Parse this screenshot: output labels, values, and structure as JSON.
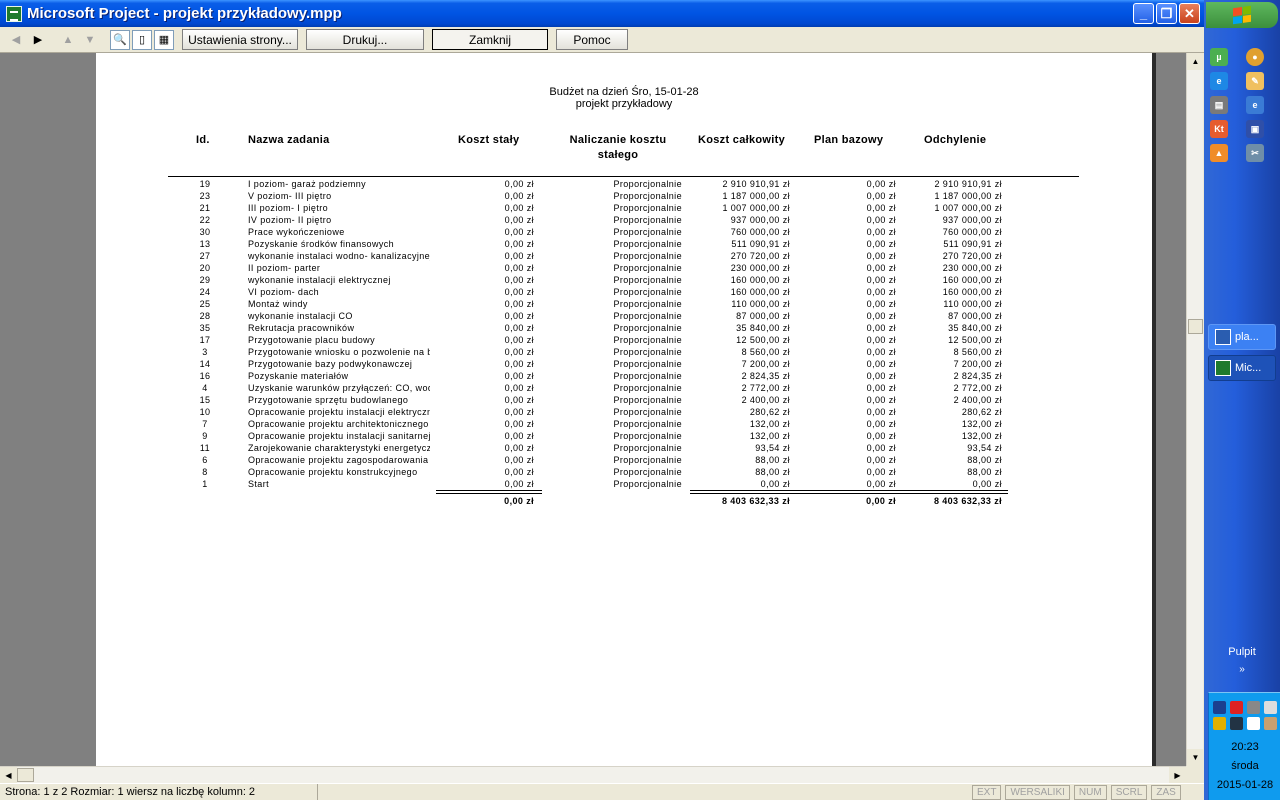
{
  "window": {
    "title": "Microsoft Project - projekt przykładowy.mpp"
  },
  "toolbar": {
    "page_setup": "Ustawienia strony...",
    "print": "Drukuj...",
    "close": "Zamknij",
    "help": "Pomoc"
  },
  "report": {
    "title": "Budżet na dzień Śro, 15-01-28",
    "project": "projekt przykładowy",
    "columns": {
      "id": "Id.",
      "name": "Nazwa zadania",
      "fixed_cost": "Koszt stały",
      "accrual_l1": "Naliczanie kosztu",
      "accrual_l2": "stałego",
      "total_cost": "Koszt całkowity",
      "baseline": "Plan bazowy",
      "variance": "Odchylenie"
    },
    "rows": [
      {
        "id": "19",
        "name": "I poziom- garaż podziemny",
        "fixed": "0,00 zł",
        "accrual": "Proporcjonalnie",
        "total": "2 910 910,91 zł",
        "baseline": "0,00 zł",
        "variance": "2 910 910,91 zł"
      },
      {
        "id": "23",
        "name": "V poziom- III piętro",
        "fixed": "0,00 zł",
        "accrual": "Proporcjonalnie",
        "total": "1 187 000,00 zł",
        "baseline": "0,00 zł",
        "variance": "1 187 000,00 zł"
      },
      {
        "id": "21",
        "name": "III poziom- I piętro",
        "fixed": "0,00 zł",
        "accrual": "Proporcjonalnie",
        "total": "1 007 000,00 zł",
        "baseline": "0,00 zł",
        "variance": "1 007 000,00 zł"
      },
      {
        "id": "22",
        "name": "IV poziom- II piętro",
        "fixed": "0,00 zł",
        "accrual": "Proporcjonalnie",
        "total": "937 000,00 zł",
        "baseline": "0,00 zł",
        "variance": "937 000,00 zł"
      },
      {
        "id": "30",
        "name": "Prace wykończeniowe",
        "fixed": "0,00 zł",
        "accrual": "Proporcjonalnie",
        "total": "760 000,00 zł",
        "baseline": "0,00 zł",
        "variance": "760 000,00 zł"
      },
      {
        "id": "13",
        "name": "Pozyskanie środków finansowych",
        "fixed": "0,00 zł",
        "accrual": "Proporcjonalnie",
        "total": "511 090,91 zł",
        "baseline": "0,00 zł",
        "variance": "511 090,91 zł"
      },
      {
        "id": "27",
        "name": "wykonanie instalaci wodno- kanalizacyjnej",
        "fixed": "0,00 zł",
        "accrual": "Proporcjonalnie",
        "total": "270 720,00 zł",
        "baseline": "0,00 zł",
        "variance": "270 720,00 zł"
      },
      {
        "id": "20",
        "name": "II poziom- parter",
        "fixed": "0,00 zł",
        "accrual": "Proporcjonalnie",
        "total": "230 000,00 zł",
        "baseline": "0,00 zł",
        "variance": "230 000,00 zł"
      },
      {
        "id": "29",
        "name": "wykonanie instalacji elektrycznej",
        "fixed": "0,00 zł",
        "accrual": "Proporcjonalnie",
        "total": "160 000,00 zł",
        "baseline": "0,00 zł",
        "variance": "160 000,00 zł"
      },
      {
        "id": "24",
        "name": "VI poziom- dach",
        "fixed": "0,00 zł",
        "accrual": "Proporcjonalnie",
        "total": "160 000,00 zł",
        "baseline": "0,00 zł",
        "variance": "160 000,00 zł"
      },
      {
        "id": "25",
        "name": "Montaż windy",
        "fixed": "0,00 zł",
        "accrual": "Proporcjonalnie",
        "total": "110 000,00 zł",
        "baseline": "0,00 zł",
        "variance": "110 000,00 zł"
      },
      {
        "id": "28",
        "name": "wykonanie instalacji CO",
        "fixed": "0,00 zł",
        "accrual": "Proporcjonalnie",
        "total": "87 000,00 zł",
        "baseline": "0,00 zł",
        "variance": "87 000,00 zł"
      },
      {
        "id": "35",
        "name": "Rekrutacja pracowników",
        "fixed": "0,00 zł",
        "accrual": "Proporcjonalnie",
        "total": "35 840,00 zł",
        "baseline": "0,00 zł",
        "variance": "35 840,00 zł"
      },
      {
        "id": "17",
        "name": "Przygotowanie placu budowy",
        "fixed": "0,00 zł",
        "accrual": "Proporcjonalnie",
        "total": "12 500,00 zł",
        "baseline": "0,00 zł",
        "variance": "12 500,00 zł"
      },
      {
        "id": "3",
        "name": "Przygotowanie wniosku o pozwolenie na budowę",
        "fixed": "0,00 zł",
        "accrual": "Proporcjonalnie",
        "total": "8 560,00 zł",
        "baseline": "0,00 zł",
        "variance": "8 560,00 zł"
      },
      {
        "id": "14",
        "name": "Przygotowanie bazy podwykonawczej",
        "fixed": "0,00 zł",
        "accrual": "Proporcjonalnie",
        "total": "7 200,00 zł",
        "baseline": "0,00 zł",
        "variance": "7 200,00 zł"
      },
      {
        "id": "16",
        "name": "Pozyskanie materiałów",
        "fixed": "0,00 zł",
        "accrual": "Proporcjonalnie",
        "total": "2 824,35 zł",
        "baseline": "0,00 zł",
        "variance": "2 824,35 zł"
      },
      {
        "id": "4",
        "name": "Uzyskanie warunków przyłączeń: CO, wod-kan, elektr.",
        "fixed": "0,00 zł",
        "accrual": "Proporcjonalnie",
        "total": "2 772,00 zł",
        "baseline": "0,00 zł",
        "variance": "2 772,00 zł"
      },
      {
        "id": "15",
        "name": "Przygotowanie sprzętu budowlanego",
        "fixed": "0,00 zł",
        "accrual": "Proporcjonalnie",
        "total": "2 400,00 zł",
        "baseline": "0,00 zł",
        "variance": "2 400,00 zł"
      },
      {
        "id": "10",
        "name": "Opracowanie projektu instalacji elektrycznej",
        "fixed": "0,00 zł",
        "accrual": "Proporcjonalnie",
        "total": "280,62 zł",
        "baseline": "0,00 zł",
        "variance": "280,62 zł"
      },
      {
        "id": "7",
        "name": "Opracowanie projektu architektonicznego",
        "fixed": "0,00 zł",
        "accrual": "Proporcjonalnie",
        "total": "132,00 zł",
        "baseline": "0,00 zł",
        "variance": "132,00 zł"
      },
      {
        "id": "9",
        "name": "Opracowanie projektu instalacji sanitarnej",
        "fixed": "0,00 zł",
        "accrual": "Proporcjonalnie",
        "total": "132,00 zł",
        "baseline": "0,00 zł",
        "variance": "132,00 zł"
      },
      {
        "id": "11",
        "name": "Zarojekowanie charakterystyki energetycznej",
        "fixed": "0,00 zł",
        "accrual": "Proporcjonalnie",
        "total": "93,54 zł",
        "baseline": "0,00 zł",
        "variance": "93,54 zł"
      },
      {
        "id": "6",
        "name": "Opracowanie projektu zagospodarowania terenu",
        "fixed": "0,00 zł",
        "accrual": "Proporcjonalnie",
        "total": "88,00 zł",
        "baseline": "0,00 zł",
        "variance": "88,00 zł"
      },
      {
        "id": "8",
        "name": "Opracowanie projektu konstrukcyjnego",
        "fixed": "0,00 zł",
        "accrual": "Proporcjonalnie",
        "total": "88,00 zł",
        "baseline": "0,00 zł",
        "variance": "88,00 zł"
      },
      {
        "id": "1",
        "name": "Start",
        "fixed": "0,00 zł",
        "accrual": "Proporcjonalnie",
        "total": "0,00 zł",
        "baseline": "0,00 zł",
        "variance": "0,00 zł"
      }
    ],
    "totals": {
      "fixed": "0,00 zł",
      "total": "8 403 632,33 zł",
      "baseline": "0,00 zł",
      "variance": "8 403 632,33 zł"
    }
  },
  "status": {
    "text": "Strona: 1 z 2   Rozmiar: 1 wiersz na liczbę kolumn: 2",
    "ext": "EXT",
    "caps": "WERSALIKI",
    "num": "NUM",
    "scrl": "SCRL",
    "ovr": "ZAS"
  },
  "taskbar": {
    "task1": "pla...",
    "task2": "Mic...",
    "desktop": "Pulpit",
    "time": "20:23",
    "day": "środa",
    "date": "2015-01-28"
  }
}
